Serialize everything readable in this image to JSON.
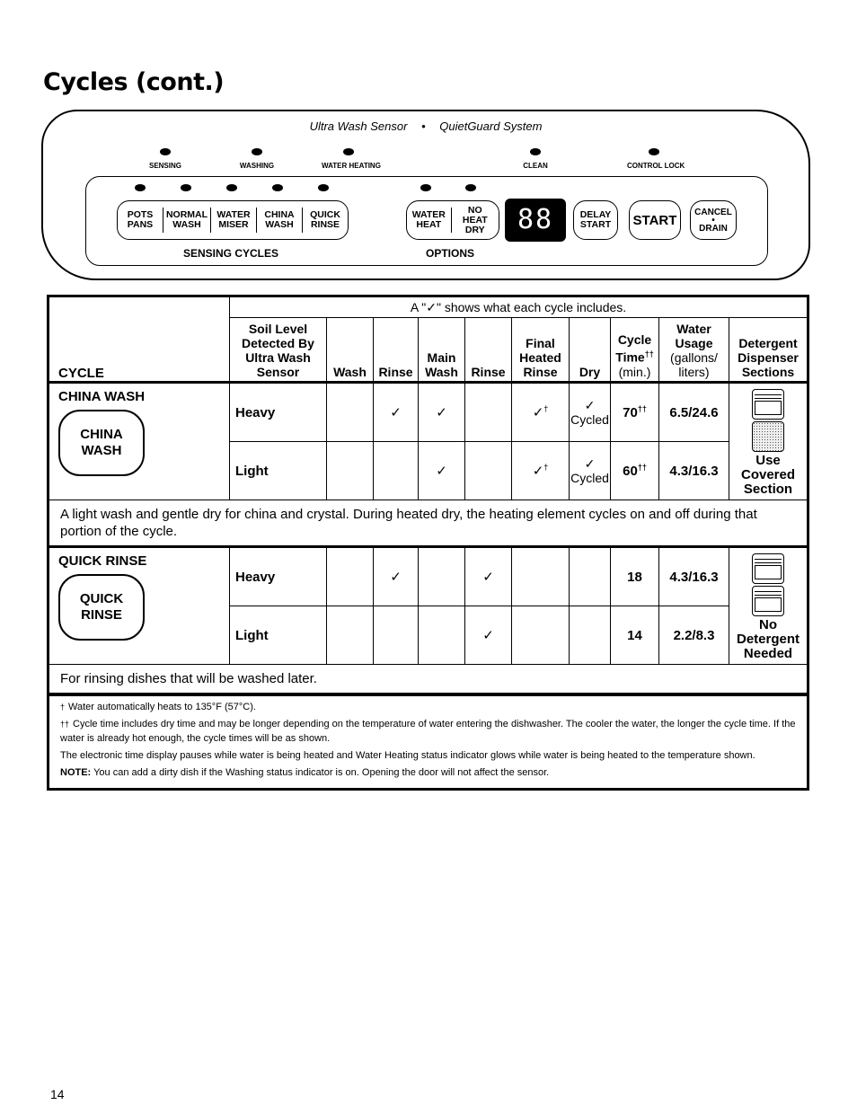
{
  "page": {
    "title": "Cycles (cont.)",
    "page_number": "14"
  },
  "control_panel": {
    "header_left": "Ultra Wash Sensor",
    "header_separator": "•",
    "header_right": "QuietGuard System",
    "status_indicators": [
      "SENSING",
      "WASHING",
      "WATER HEATING",
      "CLEAN",
      "CONTROL LOCK"
    ],
    "sensing_cycles": {
      "caption": "SENSING CYCLES",
      "buttons": [
        {
          "line1": "POTS",
          "line2": "PANS"
        },
        {
          "line1": "NORMAL",
          "line2": "WASH"
        },
        {
          "line1": "WATER",
          "line2": "MISER"
        },
        {
          "line1": "CHINA",
          "line2": "WASH"
        },
        {
          "line1": "QUICK",
          "line2": "RINSE"
        }
      ]
    },
    "options": {
      "caption": "OPTIONS",
      "buttons": [
        {
          "line1": "WATER",
          "line2": "HEAT"
        },
        {
          "line1": "NO HEAT",
          "line2": "DRY"
        }
      ]
    },
    "display_text": "88",
    "delay_start": {
      "line1": "DELAY",
      "line2": "START"
    },
    "start": "START",
    "cancel_drain": {
      "line1": "CANCEL",
      "line2": "•",
      "line3": "DRAIN"
    }
  },
  "table": {
    "caption": "A \"✓\" shows what each cycle includes.",
    "headers": {
      "cycle": "CYCLE",
      "soil": [
        "Soil Level",
        "Detected By",
        "Ultra Wash",
        "Sensor"
      ],
      "wash": "Wash",
      "rinse1": "Rinse",
      "main_wash": [
        "Main",
        "Wash"
      ],
      "rinse2": "Rinse",
      "final_heated_rinse": [
        "Final",
        "Heated",
        "Rinse"
      ],
      "dry": "Dry",
      "cycle_time": [
        "Cycle",
        "Time",
        "††",
        "(min.)"
      ],
      "water_usage": [
        "Water",
        "Usage",
        "(gallons/",
        "liters)"
      ],
      "detergent": [
        "Detergent",
        "Dispenser",
        "Sections"
      ]
    },
    "cycles": [
      {
        "name": "CHINA WASH",
        "button": {
          "line1": "CHINA",
          "line2": "WASH"
        },
        "rows": [
          {
            "soil": "Heavy",
            "wash": "",
            "rinse1": "✓",
            "main_wash": "✓",
            "rinse2": "",
            "final": "✓",
            "final_mark": "†",
            "dry": "✓",
            "dry_note": "Cycled",
            "time": "70",
            "time_mark": "††",
            "water": "6.5/24.6"
          },
          {
            "soil": "Light",
            "wash": "",
            "rinse1": "",
            "main_wash": "✓",
            "rinse2": "",
            "final": "✓",
            "final_mark": "†",
            "dry": "✓",
            "dry_note": "Cycled",
            "time": "60",
            "time_mark": "††",
            "water": "4.3/16.3"
          }
        ],
        "detergent_icon": "dispenser-covered-filled-icon",
        "detergent_label": [
          "Use",
          "Covered",
          "Section"
        ],
        "description": "A light wash and gentle dry for china and crystal. During heated dry, the heating element cycles on and off during that portion of the cycle."
      },
      {
        "name": "QUICK RINSE",
        "button": {
          "line1": "QUICK",
          "line2": "RINSE"
        },
        "rows": [
          {
            "soil": "Heavy",
            "wash": "",
            "rinse1": "✓",
            "main_wash": "",
            "rinse2": "✓",
            "final": "",
            "final_mark": "",
            "dry": "",
            "dry_note": "",
            "time": "18",
            "time_mark": "",
            "water": "4.3/16.3"
          },
          {
            "soil": "Light",
            "wash": "",
            "rinse1": "",
            "main_wash": "",
            "rinse2": "✓",
            "final": "",
            "final_mark": "",
            "dry": "",
            "dry_note": "",
            "time": "14",
            "time_mark": "",
            "water": "2.2/8.3"
          }
        ],
        "detergent_icon": "dispenser-empty-icon",
        "detergent_label": [
          "No",
          "Detergent",
          "Needed"
        ],
        "description": "For rinsing dishes that will be washed later."
      }
    ]
  },
  "footnotes": [
    {
      "mark": "†",
      "text": "Water automatically heats to 135°F (57°C)."
    },
    {
      "mark": "††",
      "text": "Cycle time includes dry time and may be longer depending on the temperature of water entering the dishwasher. The cooler the water, the longer the cycle time. If the water is already hot enough, the cycle times will be as shown."
    },
    {
      "mark": "",
      "text": "The electronic time display pauses while water is being heated and Water Heating status indicator glows while water is being heated to the temperature shown."
    },
    {
      "mark": "",
      "label": "NOTE:",
      "text": "You can add a dirty dish if the Washing status indicator is on. Opening the door will not affect the sensor."
    }
  ]
}
